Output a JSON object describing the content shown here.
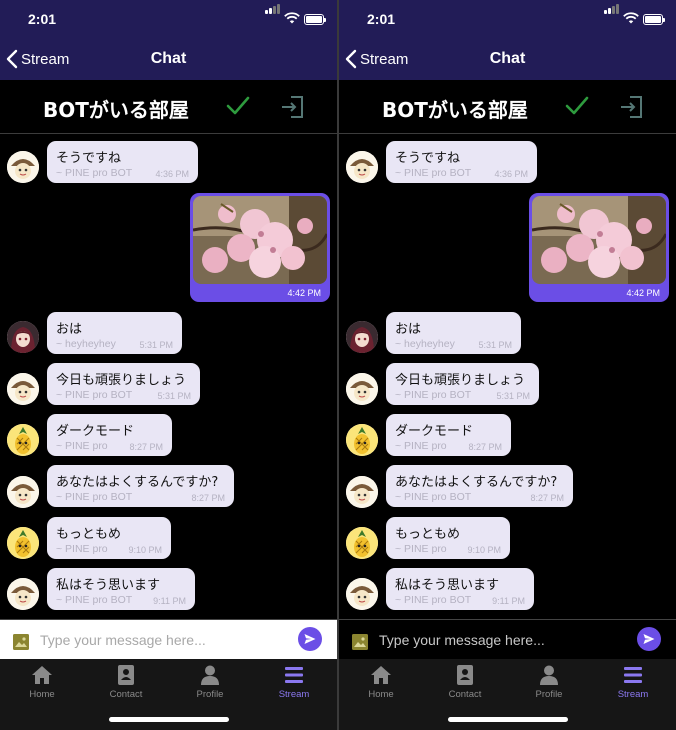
{
  "status_bar": {
    "time": "2:01"
  },
  "nav": {
    "back_label": "Stream",
    "title": "Chat"
  },
  "room": {
    "name": "BOTがいる部屋"
  },
  "messages": [
    {
      "text": "そうですね",
      "sender": "~ PINE pro BOT",
      "time": "4:36 PM",
      "avatar": "bot-character-avatar"
    },
    {
      "type": "image",
      "image": "cherry-blossom-photo",
      "time": "4:42 PM",
      "outgoing": true
    },
    {
      "text": "おは",
      "sender": "~ heyheyhey",
      "time": "5:31 PM",
      "avatar": "anime-girl-avatar"
    },
    {
      "text": "今日も頑張りましょう",
      "sender": "~ PINE pro BOT",
      "time": "5:31 PM",
      "avatar": "bot-character-avatar"
    },
    {
      "text": "ダークモード",
      "sender": "~ PINE pro",
      "time": "8:27 PM",
      "avatar": "pineapple-avatar"
    },
    {
      "text": "あなたはよくするんですか?",
      "sender": "~ PINE pro BOT",
      "time": "8:27 PM",
      "avatar": "bot-character-avatar"
    },
    {
      "text": "もっともめ",
      "sender": "~ PINE pro",
      "time": "9:10 PM",
      "avatar": "pineapple-avatar"
    },
    {
      "text": "私はそう思います",
      "sender": "~ PINE pro BOT",
      "time": "9:11 PM",
      "avatar": "bot-character-avatar"
    }
  ],
  "composer": {
    "placeholder": "Type your message here..."
  },
  "tabs": [
    {
      "label": "Home",
      "icon": "home-icon"
    },
    {
      "label": "Contact",
      "icon": "contact-book-icon"
    },
    {
      "label": "Profile",
      "icon": "person-icon"
    },
    {
      "label": "Stream",
      "icon": "stream-icon",
      "active": true
    }
  ],
  "colors": {
    "nav_bg": "#221c57",
    "accent": "#6b4ee6",
    "bubble_bg": "#e9e6f5",
    "check_green": "#2e9b3e",
    "active_tab": "#8b78f0"
  }
}
